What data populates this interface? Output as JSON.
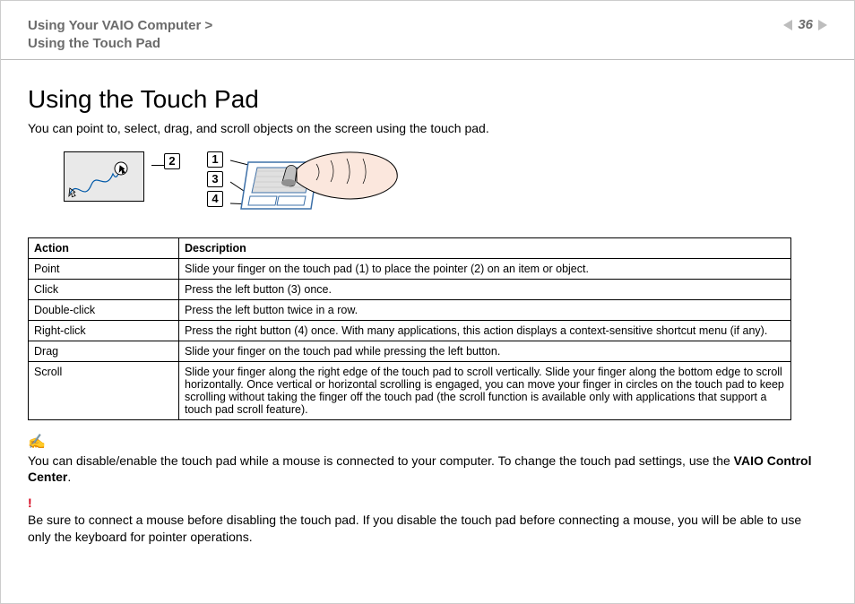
{
  "header": {
    "crumb1": "Using Your VAIO Computer >",
    "crumb2": "Using the Touch Pad",
    "page_number": "36"
  },
  "title": "Using the Touch Pad",
  "intro": "You can point to, select, drag, and scroll objects on the screen using the touch pad.",
  "callouts": {
    "c1": "1",
    "c2": "2",
    "c3": "3",
    "c4": "4"
  },
  "table": {
    "head_action": "Action",
    "head_desc": "Description",
    "rows": [
      {
        "action": "Point",
        "desc": "Slide your finger on the touch pad (1) to place the pointer (2) on an item or object."
      },
      {
        "action": "Click",
        "desc": "Press the left button (3) once."
      },
      {
        "action": "Double-click",
        "desc": "Press the left button twice in a row."
      },
      {
        "action": "Right-click",
        "desc": "Press the right button (4) once. With many applications, this action displays a context-sensitive shortcut menu (if any)."
      },
      {
        "action": "Drag",
        "desc": "Slide your finger on the touch pad while pressing the left button."
      },
      {
        "action": "Scroll",
        "desc": "Slide your finger along the right edge of the touch pad to scroll vertically. Slide your finger along the bottom edge to scroll horizontally. Once vertical or horizontal scrolling is engaged, you can move your finger in circles on the touch pad to keep scrolling without taking the finger off the touch pad (the scroll function is available only with applications that support a touch pad scroll feature)."
      }
    ]
  },
  "note": {
    "text_a": "You can disable/enable the touch pad while a mouse is connected to your computer. To change the touch pad settings, use the ",
    "bold_text": "VAIO Control Center",
    "text_b": "."
  },
  "warning": "Be sure to connect a mouse before disabling the touch pad. If you disable the touch pad before connecting a mouse, you will be able to use only the keyboard for pointer operations."
}
